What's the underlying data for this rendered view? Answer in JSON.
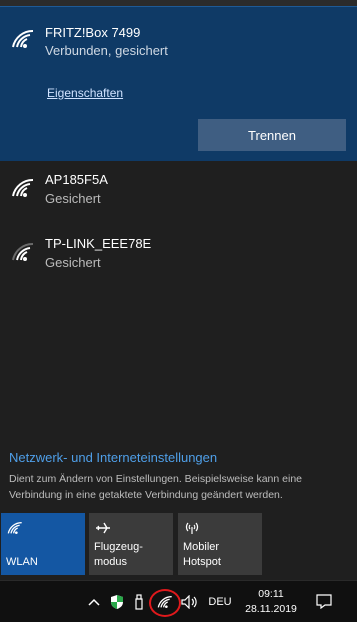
{
  "networks": {
    "connected": {
      "name": "FRITZ!Box 7499",
      "status": "Verbunden, gesichert",
      "properties_label": "Eigenschaften",
      "disconnect_label": "Trennen"
    },
    "others": [
      {
        "name": "AP185F5A",
        "status": "Gesichert"
      },
      {
        "name": "TP-LINK_EEE78E",
        "status": "Gesichert"
      }
    ]
  },
  "settings": {
    "title": "Netzwerk- und Interneteinstellungen",
    "description": "Dient zum Ändern von Einstellungen. Beispielsweise kann eine Verbindung in eine getaktete Verbindung geändert werden."
  },
  "quick_actions": [
    {
      "label": "WLAN",
      "icon": "wifi-icon",
      "active": true
    },
    {
      "label": "Flugzeug-\nmodus",
      "icon": "airplane-icon",
      "active": false
    },
    {
      "label": "Mobiler\nHotspot",
      "icon": "hotspot-icon",
      "active": false
    }
  ],
  "taskbar": {
    "language": "DEU",
    "time": "09:11",
    "date": "28.11.2019",
    "icons": [
      "chevron-up-icon",
      "defender-icon",
      "usb-icon",
      "wifi-icon",
      "volume-icon",
      "notification-icon"
    ]
  },
  "colors": {
    "connected_bg": "#0f3a66",
    "accent": "#1457a3",
    "link": "#4f9fe8",
    "highlight_circle": "#e0191c"
  }
}
